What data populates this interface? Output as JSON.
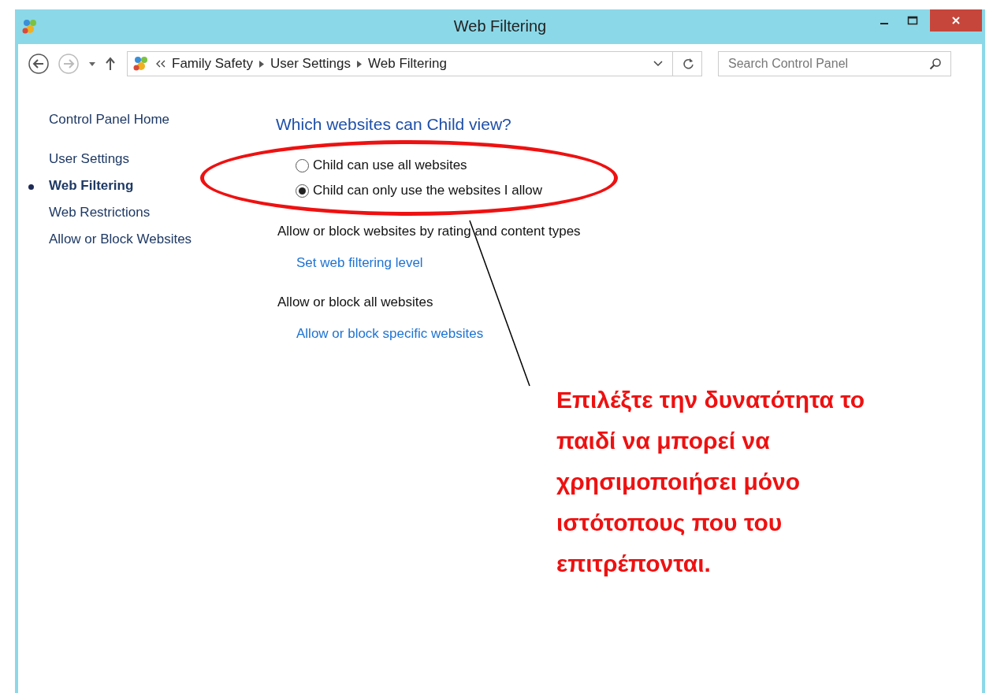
{
  "window": {
    "title": "Web Filtering"
  },
  "address": {
    "crumbs": [
      "Family Safety",
      "User Settings",
      "Web Filtering"
    ]
  },
  "search": {
    "placeholder": "Search Control Panel"
  },
  "sidebar": {
    "home": "Control Panel Home",
    "items": [
      {
        "label": "User Settings",
        "selected": false
      },
      {
        "label": "Web Filtering",
        "selected": true
      },
      {
        "label": "Web Restrictions",
        "selected": false
      },
      {
        "label": "Allow or Block Websites",
        "selected": false
      }
    ]
  },
  "heading": "Which websites can Child view?",
  "options": [
    {
      "label": "Child can use all websites",
      "selected": false
    },
    {
      "label": "Child can only use the websites I allow",
      "selected": true
    }
  ],
  "sections": [
    {
      "text": "Allow or block websites by rating and content types",
      "link": "Set web filtering level"
    },
    {
      "text": "Allow or block all websites",
      "link": "Allow or block specific websites"
    }
  ],
  "annotation": "Επιλέξτε την δυνατότητα το παιδί να μπορεί να χρησιμοποιήσει μόνο ιστότοπους που του επιτρέπονται."
}
